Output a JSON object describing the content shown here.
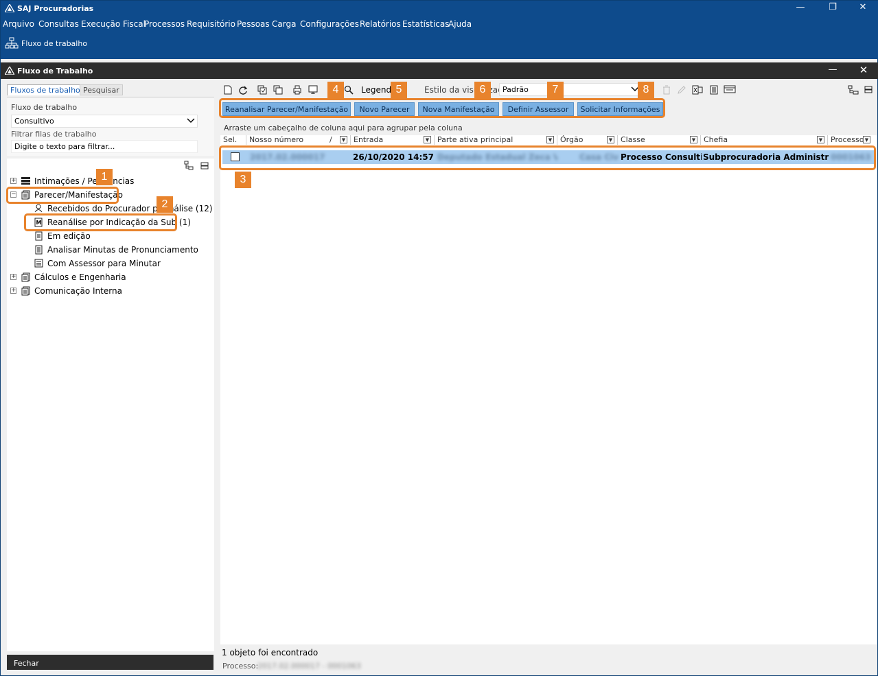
{
  "window": {
    "title": "SAJ Procuradorias",
    "minimize": "—",
    "maximize": "❐",
    "close": "✕"
  },
  "menu": [
    "Arquivo",
    "Consultas",
    "Execução Fiscal",
    "Processos",
    "Requisitório",
    "Pessoas",
    "Carga",
    "Configurações",
    "Relatórios",
    "Estatísticas",
    "Ajuda"
  ],
  "ribbon": {
    "item": "Fluxo de trabalho"
  },
  "subwindow": {
    "title": "Fluxo de Trabalho",
    "minimize": "—",
    "close": "✕"
  },
  "left": {
    "tabs": [
      "Fluxos de trabalho",
      "Pesquisar"
    ],
    "workflow_label": "Fluxo de trabalho",
    "workflow_value": "Consultivo",
    "filter_label": "Filtrar filas de trabalho",
    "filter_placeholder": "Digite o texto para filtrar...",
    "tree": [
      {
        "label": "Intimações / Pendências",
        "level": 0,
        "expander": "+"
      },
      {
        "label": "Parecer/Manifestação",
        "level": 0,
        "expander": "−"
      },
      {
        "label": "Recebidos do Procurador p/ Análise (12)",
        "level": 1
      },
      {
        "label": "Reanálise por Indicação da Sub (1)",
        "level": 1
      },
      {
        "label": "Em edição",
        "level": 1
      },
      {
        "label": "Analisar Minutas de Pronunciamento",
        "level": 1
      },
      {
        "label": "Com Assessor para Minutar",
        "level": 1
      },
      {
        "label": "Cálculos e Engenharia",
        "level": 0,
        "expander": "+"
      },
      {
        "label": "Comunicação Interna",
        "level": 0,
        "expander": "+"
      }
    ],
    "close_button": "Fechar"
  },
  "toolbar": {
    "legend_label": "Legenda",
    "style_label": "Estilo da visualização",
    "style_value": "Padrão"
  },
  "actions": [
    "Reanalisar Parecer/Manifestação",
    "Novo Parecer",
    "Nova Manifestação",
    "Definir Assessor",
    "Solicitar Informações"
  ],
  "grid": {
    "group_hint": "Arraste um cabeçalho de coluna aqui para agrupar pela coluna",
    "columns": [
      "Sel.",
      "Nosso número",
      "Entrada",
      "Parte ativa principal",
      "Órgão",
      "Classe",
      "Chefia",
      "Processo"
    ],
    "sort_indicator": "/",
    "rows": [
      {
        "nosso_numero": "2017.02.000017",
        "entrada": "26/10/2020 14:57",
        "parte": "Deputado Estadual Zeca Vio Ci",
        "orgao": "Casa Civi",
        "classe": "Processo Consultivo",
        "chefia": "Subprocuradoria Administrativa",
        "processo": "0001063"
      }
    ]
  },
  "status": {
    "count_text": "1 objeto foi encontrado",
    "process_label": "Processo:",
    "process_value": "2017.02.000017 - 0001063"
  },
  "callouts": [
    "1",
    "2",
    "3",
    "4",
    "5",
    "6",
    "7",
    "8"
  ],
  "colors": {
    "title_bar": "#0e4b8c",
    "dark_bar": "#2d2d2d",
    "action_button": "#7ab0e2",
    "selected_row": "#a9cef0",
    "callout": "#e8832c"
  }
}
